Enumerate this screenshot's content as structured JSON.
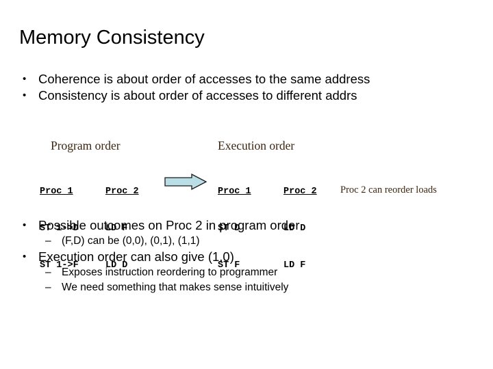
{
  "slide": {
    "title": "Memory Consistency",
    "background_color": "#ffffff",
    "text_color": "#000000",
    "accent_color": "#3d2611",
    "arrow_fill": "#b9dee6",
    "arrow_stroke": "#1a1a1a"
  },
  "bullets_top": [
    {
      "marker": "•",
      "text": "Coherence is about order of accesses to the same address"
    },
    {
      "marker": "•",
      "text": "Consistency is about order of accesses to different addrs"
    }
  ],
  "diagram": {
    "program_order_heading": "Program order",
    "execution_order_heading": "Execution order",
    "arrow_name": "right-arrow",
    "side_note": "Proc 2 can reorder loads",
    "program_order_table": {
      "headers": [
        "Proc 1",
        "Proc 2"
      ],
      "rows": [
        [
          "ST 1->D",
          "LD F"
        ],
        [
          "ST 1->F",
          "LD D"
        ]
      ]
    },
    "execution_order_table": {
      "headers": [
        "Proc 1",
        "Proc 2"
      ],
      "rows": [
        [
          "ST D",
          "LD D"
        ],
        [
          "ST F",
          "LD F"
        ]
      ]
    }
  },
  "bullets_bottom": [
    {
      "marker": "•",
      "level": 1,
      "text": "Possible outcomes on Proc 2 in program order"
    },
    {
      "marker": "–",
      "level": 2,
      "text": "(F,D) can be (0,0), (0,1), (1,1)"
    },
    {
      "marker": "•",
      "level": 1,
      "text": "Execution order can also give (1,0)"
    },
    {
      "marker": "–",
      "level": 2,
      "text": "Exposes instruction reordering to programmer"
    },
    {
      "marker": "–",
      "level": 2,
      "text": "We need something that makes sense intuitively"
    }
  ]
}
